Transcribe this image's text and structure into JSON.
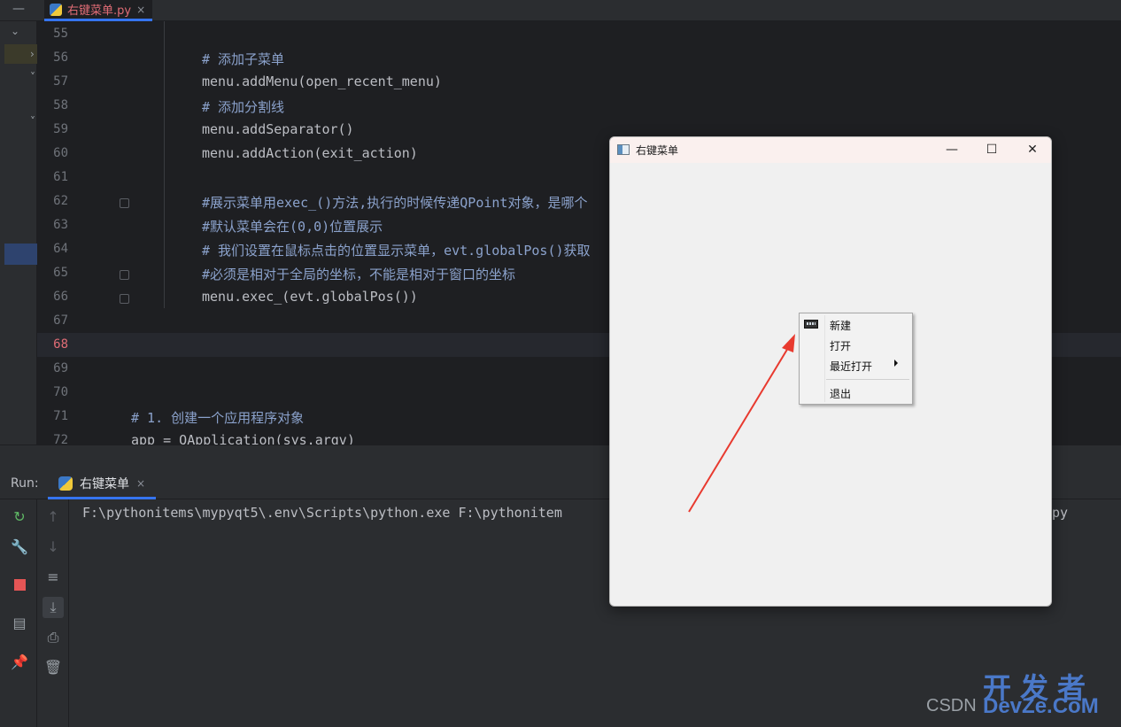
{
  "editor": {
    "tab": {
      "filename": "右键菜单.py",
      "close": "×"
    },
    "current_line": "68",
    "lines": [
      {
        "n": "55",
        "code": ""
      },
      {
        "n": "56",
        "code": "# 添加子菜单"
      },
      {
        "n": "57",
        "code": "menu.addMenu(open_recent_menu)"
      },
      {
        "n": "58",
        "code": "# 添加分割线"
      },
      {
        "n": "59",
        "code": "menu.addSeparator()"
      },
      {
        "n": "60",
        "code": "menu.addAction(exit_action)"
      },
      {
        "n": "61",
        "code": ""
      },
      {
        "n": "62",
        "code": "#展示菜单用exec_()方法,执行的时候传递QPoint对象，是哪个"
      },
      {
        "n": "63",
        "code": "#默认菜单会在(0,0)位置展示"
      },
      {
        "n": "64",
        "code": "# 我们设置在鼠标点击的位置显示菜单，evt.globalPos()获取"
      },
      {
        "n": "65",
        "code": "#必须是相对于全局的坐标，不能是相对于窗口的坐标"
      },
      {
        "n": "66",
        "code": "menu.exec_(evt.globalPos())"
      },
      {
        "n": "67",
        "code": ""
      },
      {
        "n": "68",
        "code": ""
      },
      {
        "n": "69",
        "code": ""
      },
      {
        "n": "70",
        "code": ""
      },
      {
        "n": "71",
        "code": "# 1. 创建一个应用程序对象"
      },
      {
        "n": "72",
        "code": "app = QApplication(sys.argv)"
      }
    ]
  },
  "run": {
    "label": "Run:",
    "tab": "右键菜单",
    "close": "×",
    "console_line": "F:\\pythonitems\\mypyqt5\\.env\\Scripts\\python.exe F:\\pythonitem",
    "console_tail": "py"
  },
  "qt_window": {
    "title": "右键菜单",
    "minimize": "—",
    "maximize": "☐",
    "close": "✕",
    "menu": {
      "items": [
        "新建",
        "打开",
        "最近打开",
        "退出"
      ]
    }
  },
  "watermark": {
    "big": "开发者",
    "small": "CSDN",
    "domain": "DevZe.CoM"
  },
  "colors": {
    "accent": "#3574f0",
    "editor_bg": "#1e1f22",
    "arrow": "#e83a2f"
  }
}
